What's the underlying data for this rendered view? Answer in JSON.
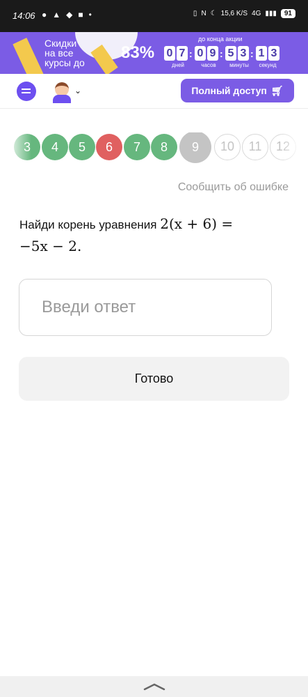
{
  "status_bar": {
    "time": "14:06",
    "speed": "15,6",
    "speed_unit": "K/S",
    "network": "4G",
    "battery": "91"
  },
  "promo": {
    "text_line1": "Скидки",
    "text_line2": "на все",
    "text_line3": "курсы до",
    "percent": "83%",
    "until_label": "до конца акции",
    "timer": [
      {
        "digits": [
          "0",
          "7"
        ],
        "label": "дней"
      },
      {
        "digits": [
          "0",
          "9"
        ],
        "label": "часов"
      },
      {
        "digits": [
          "5",
          "3"
        ],
        "label": "минуты"
      },
      {
        "digits": [
          "1",
          "3"
        ],
        "label": "секунд"
      }
    ],
    "colors": {
      "background": "#7b5ce5",
      "accent": "#f3c94d"
    }
  },
  "header": {
    "full_access_label": "Полный доступ",
    "icons": [
      "chat-icon",
      "avatar",
      "chevron-down-icon",
      "cart-icon"
    ]
  },
  "progress": {
    "items": [
      {
        "label": "3",
        "state": "correct"
      },
      {
        "label": "4",
        "state": "correct"
      },
      {
        "label": "5",
        "state": "correct"
      },
      {
        "label": "6",
        "state": "wrong"
      },
      {
        "label": "7",
        "state": "correct"
      },
      {
        "label": "8",
        "state": "correct"
      },
      {
        "label": "9",
        "state": "current"
      },
      {
        "label": "10",
        "state": "todo"
      },
      {
        "label": "11",
        "state": "todo"
      },
      {
        "label": "12",
        "state": "todo"
      }
    ],
    "colors": {
      "correct": "#66b77e",
      "wrong": "#e06060",
      "current": "#c4c4c4"
    }
  },
  "task": {
    "report_label": "Сообщить об ошибке",
    "question_text": "Найди корень уравнения",
    "equation_line1": "2(x + 6) =",
    "equation_line2": "−5x − 2."
  },
  "answer": {
    "placeholder": "Введи ответ",
    "value": ""
  },
  "done_label": "Готово"
}
